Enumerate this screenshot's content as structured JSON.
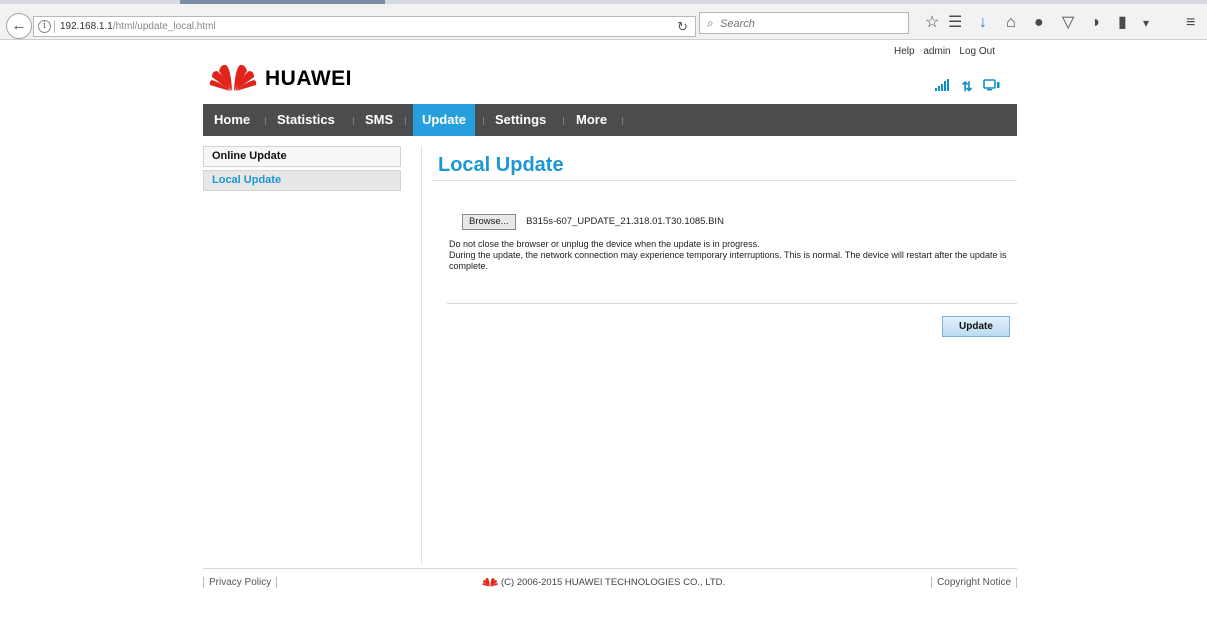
{
  "browser": {
    "url_host": "192.168.1.1",
    "url_path": "/html/update_local.html",
    "search_placeholder": "Search",
    "toolbar_icons": [
      "bookmark-star-icon",
      "reading-list-icon",
      "download-icon",
      "home-icon",
      "chat-icon",
      "pocket-icon",
      "extension-icon",
      "tablet-icon",
      "menu-icon"
    ]
  },
  "header": {
    "links": [
      "Help",
      "admin",
      "Log Out"
    ],
    "brand": "HUAWEI",
    "status_icons": [
      "signal-strength-icon",
      "data-transfer-icon",
      "connected-device-icon"
    ]
  },
  "nav": {
    "items": [
      "Home",
      "Statistics",
      "SMS",
      "Update",
      "Settings",
      "More"
    ],
    "active": "Update"
  },
  "sidebar": {
    "items": [
      "Online Update",
      "Local Update"
    ],
    "selected": "Local Update"
  },
  "main": {
    "title": "Local Update",
    "browse_label": "Browse...",
    "file_name": "B315s-607_UPDATE_21.318.01.T30.1085.BIN",
    "note_1": "Do not close the browser or unplug the device when the update is in progress.",
    "note_2": "During the update, the network connection may experience temporary interruptions. This is normal. The device will restart after the update is complete.",
    "update_label": "Update"
  },
  "footer": {
    "privacy": "Privacy Policy",
    "copyright": "(C) 2006-2015 HUAWEI TECHNOLOGIES CO., LTD.",
    "notice": "Copyright Notice"
  },
  "colors": {
    "accent": "#1c97d4",
    "nav_bg": "#4a4c4e",
    "nav_active": "#25a0dc",
    "logo_red": "#e2231a"
  }
}
